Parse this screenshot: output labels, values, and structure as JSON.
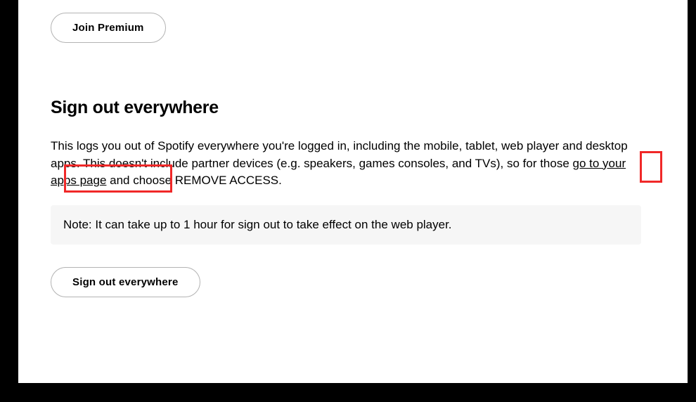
{
  "premium": {
    "join_label": "Join Premium"
  },
  "signout": {
    "heading": "Sign out everywhere",
    "desc_before_link": "This logs you out of Spotify everywhere you're logged in, including the mobile, tablet, web player and desktop apps. This doesn't include partner devices (e.g. speakers, games consoles, and TVs), so for those ",
    "link_text": "go to your apps page",
    "desc_after_link": " and choose REMOVE ACCESS.",
    "note": "Note: It can take up to 1 hour for sign out to take effect on the web player.",
    "button_label": "Sign out everywhere"
  }
}
